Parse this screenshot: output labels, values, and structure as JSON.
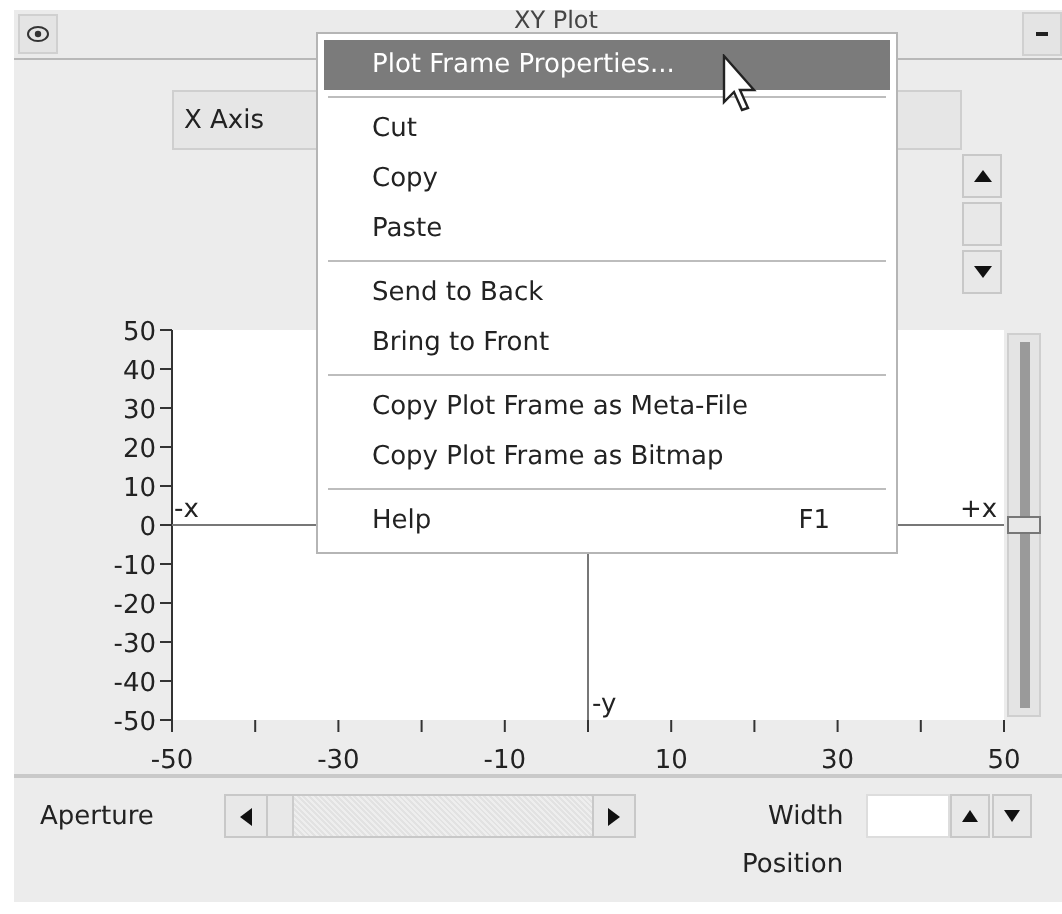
{
  "window": {
    "title": "XY Plot"
  },
  "axis_selector": {
    "label": "X Axis"
  },
  "plot": {
    "y_ticks": [
      "50",
      "40",
      "30",
      "20",
      "10",
      "0",
      "-10",
      "-20",
      "-30",
      "-40",
      "-50"
    ],
    "x_ticks": [
      "-50",
      "-30",
      "-10",
      "10",
      "30",
      "50"
    ],
    "axis_labels": {
      "neg_x": "-x",
      "pos_x": "+x",
      "neg_y": "-y"
    }
  },
  "position_slider": {
    "level": 0.5
  },
  "context_menu": {
    "items": [
      {
        "kind": "item",
        "label": "Plot Frame Properties...",
        "selected": true
      },
      {
        "kind": "separator"
      },
      {
        "kind": "item",
        "label": "Cut",
        "selected": false
      },
      {
        "kind": "item",
        "label": "Copy",
        "selected": false
      },
      {
        "kind": "item",
        "label": "Paste",
        "selected": false
      },
      {
        "kind": "separator"
      },
      {
        "kind": "item",
        "label": "Send to Back",
        "selected": false
      },
      {
        "kind": "item",
        "label": "Bring to Front",
        "selected": false
      },
      {
        "kind": "separator"
      },
      {
        "kind": "item",
        "label": "Copy Plot Frame as Meta-File",
        "selected": false
      },
      {
        "kind": "item",
        "label": "Copy Plot Frame as Bitmap",
        "selected": false
      },
      {
        "kind": "separator"
      },
      {
        "kind": "item",
        "label": "Help",
        "shortcut": "F1",
        "selected": false
      }
    ]
  },
  "aperture": {
    "label": "Aperture"
  },
  "width": {
    "label": "Width"
  },
  "position_label": "Position"
}
